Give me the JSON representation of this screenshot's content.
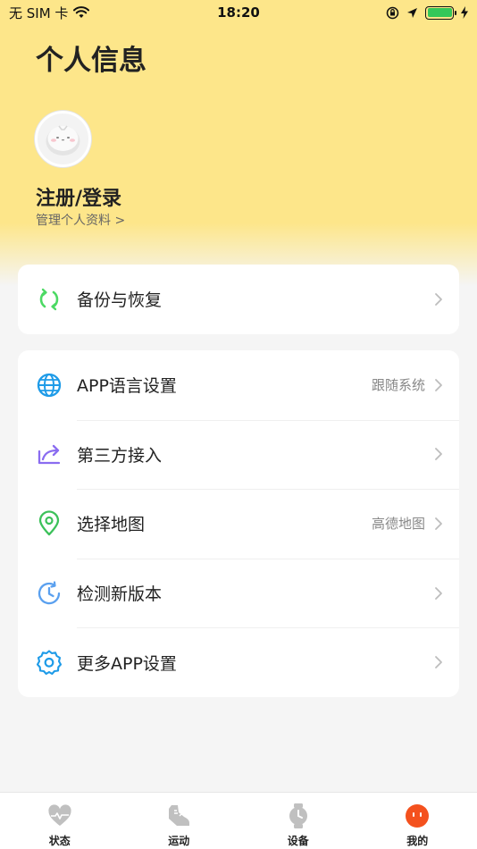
{
  "status_bar": {
    "carrier": "无 SIM 卡",
    "time": "18:20"
  },
  "header": {
    "title": "个人信息",
    "login_title": "注册/登录",
    "login_subtitle": "管理个人资料 >"
  },
  "backup_card": {
    "label": "备份与恢复"
  },
  "settings": {
    "items": [
      {
        "label": "APP语言设置",
        "value": "跟随系统",
        "icon": "globe-icon"
      },
      {
        "label": "第三方接入",
        "value": "",
        "icon": "share-icon"
      },
      {
        "label": "选择地图",
        "value": "高德地图",
        "icon": "location-pin-icon"
      },
      {
        "label": "检测新版本",
        "value": "",
        "icon": "clock-refresh-icon"
      },
      {
        "label": "更多APP设置",
        "value": "",
        "icon": "gear-icon"
      }
    ]
  },
  "tabs": [
    {
      "label": "状态",
      "icon": "heart-icon"
    },
    {
      "label": "运动",
      "icon": "shoe-icon"
    },
    {
      "label": "设备",
      "icon": "watch-icon"
    },
    {
      "label": "我的",
      "icon": "profile-face-icon",
      "active": true
    }
  ],
  "colors": {
    "header_yellow": "#fde68a",
    "backup_green": "#4cd964",
    "globe_blue": "#1e9be8",
    "share_purple": "#8a6cf0",
    "pin_green": "#3cc15a",
    "clock_blue": "#5aa0ef",
    "gear_blue": "#1e9be8",
    "active_tab_orange": "#f4511e",
    "inactive_tab_gray": "#c0c0c0",
    "battery_green": "#34c759"
  }
}
